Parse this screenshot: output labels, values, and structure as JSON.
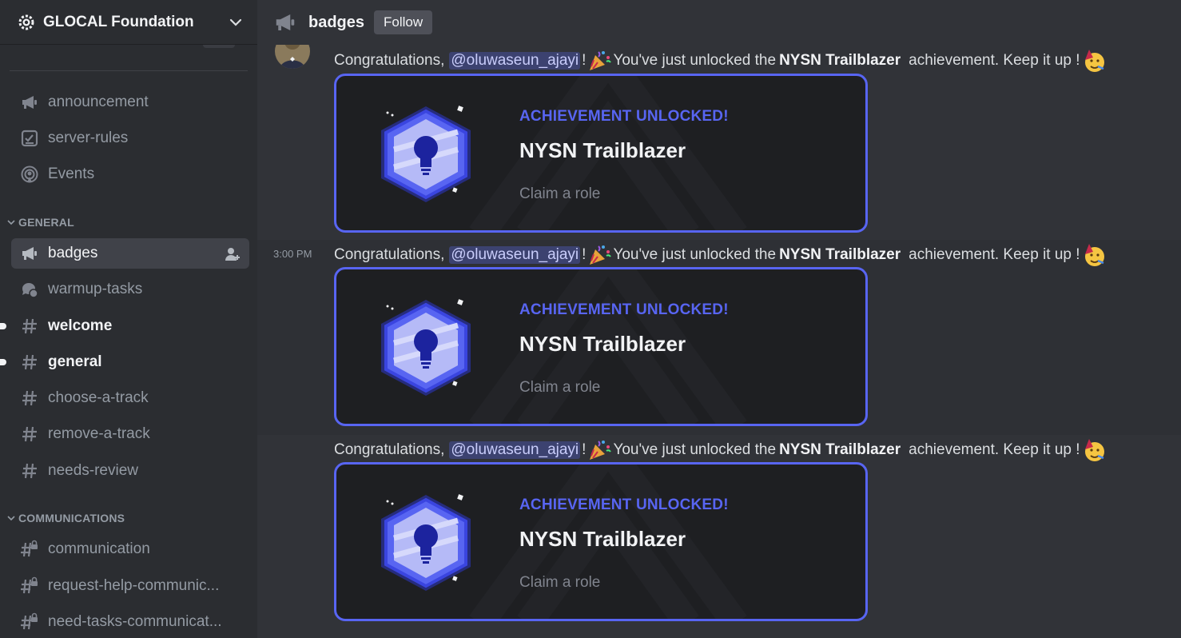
{
  "server": {
    "name": "GLOCAL Foundation"
  },
  "sidebar": {
    "top_channels": [
      {
        "label": "announcement",
        "icon": "megaphone-icon"
      },
      {
        "label": "server-rules",
        "icon": "checklist-icon"
      },
      {
        "label": "Events",
        "icon": "broadcast-icon"
      }
    ],
    "categories": [
      {
        "name": "GENERAL",
        "channels": [
          {
            "label": "badges",
            "icon": "megaphone-icon",
            "active": true
          },
          {
            "label": "warmup-tasks",
            "icon": "forum-icon"
          },
          {
            "label": "welcome",
            "icon": "hash-icon",
            "unread": true
          },
          {
            "label": "general",
            "icon": "hash-icon",
            "unread": true
          },
          {
            "label": "choose-a-track",
            "icon": "hash-icon"
          },
          {
            "label": "remove-a-track",
            "icon": "hash-icon"
          },
          {
            "label": "needs-review",
            "icon": "hash-icon"
          }
        ]
      },
      {
        "name": "COMMUNICATIONS",
        "channels": [
          {
            "label": "communication",
            "icon": "locked-hash-icon"
          },
          {
            "label": "request-help-communic...",
            "icon": "locked-hash-icon"
          },
          {
            "label": "need-tasks-communicat...",
            "icon": "locked-hash-icon"
          }
        ]
      }
    ]
  },
  "channel_header": {
    "name": "badges",
    "follow_label": "Follow"
  },
  "messages": [
    {
      "timestamp": "",
      "pre": "Congratulations,",
      "mention": "@oluwaseun_ajayi",
      "bang": "!",
      "mid": "You've just unlocked the",
      "badge_name": "NYSN Trailblazer",
      "post": "achievement. Keep it up !",
      "card": {
        "heading": "ACHIEVEMENT UNLOCKED!",
        "title": "NYSN Trailblazer",
        "action": "Claim a role"
      }
    },
    {
      "timestamp": "3:00 PM",
      "pre": "Congratulations,",
      "mention": "@oluwaseun_ajayi",
      "bang": "!",
      "mid": "You've just unlocked the",
      "badge_name": "NYSN Trailblazer",
      "post": "achievement. Keep it up !",
      "card": {
        "heading": "ACHIEVEMENT UNLOCKED!",
        "title": "NYSN Trailblazer",
        "action": "Claim a role"
      }
    },
    {
      "timestamp": "",
      "pre": "Congratulations,",
      "mention": "@oluwaseun_ajayi",
      "bang": "!",
      "mid": "You've just unlocked the",
      "badge_name": "NYSN Trailblazer",
      "post": "achievement. Keep it up !",
      "card": {
        "heading": "ACHIEVEMENT UNLOCKED!",
        "title": "NYSN Trailblazer",
        "action": "Claim a role"
      }
    }
  ],
  "colors": {
    "accent": "#5865f2",
    "sidebar": "#2b2d31",
    "main": "#313338",
    "card": "#1e1f22"
  }
}
